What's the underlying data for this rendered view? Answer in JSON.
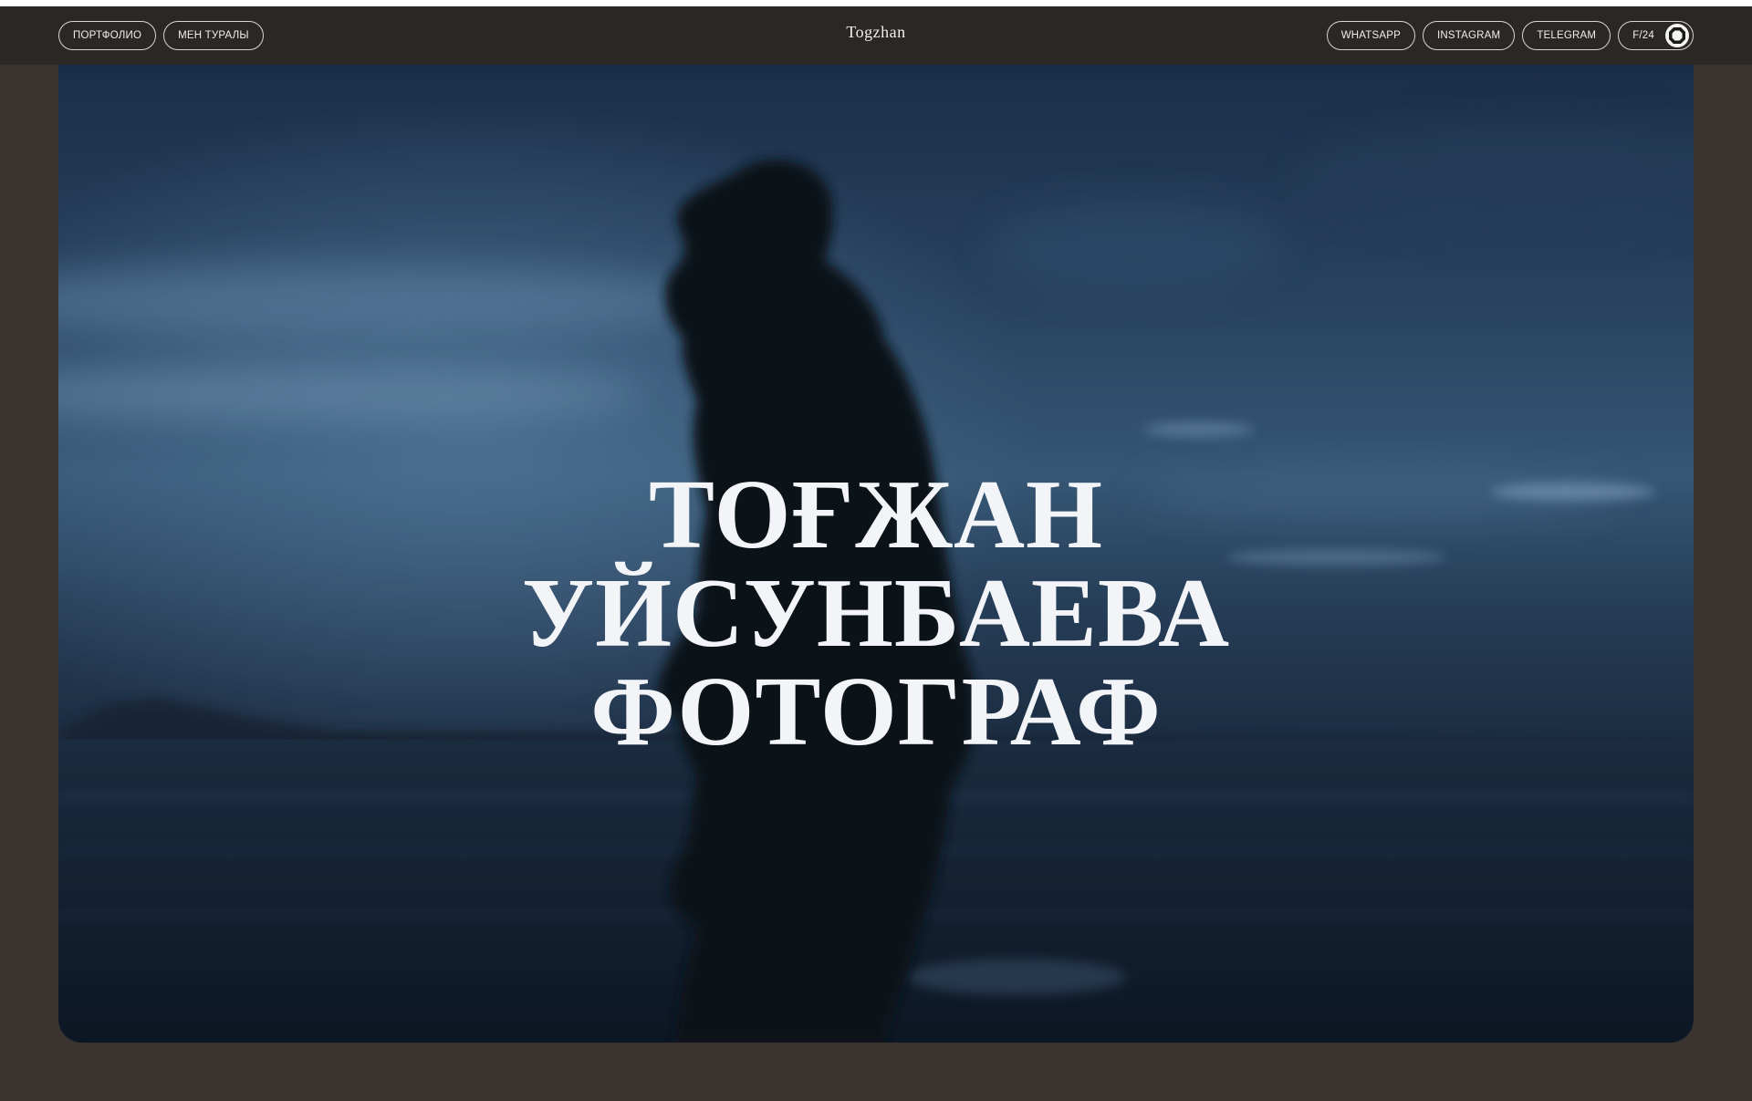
{
  "nav": {
    "left": [
      {
        "label": "ПОРТФОЛИО"
      },
      {
        "label": "МЕН ТУРАЛЫ"
      }
    ],
    "brand": "Togzhan",
    "right": [
      {
        "label": "WHATSAPP"
      },
      {
        "label": "INSTAGRAM"
      },
      {
        "label": "TELEGRAM"
      }
    ],
    "counter": {
      "label": "F/24",
      "icon": "octagon-icon"
    }
  },
  "hero": {
    "title_lines": [
      "ТОҒЖАН",
      "УЙСУНБАЕВА",
      "ФОТОГРАФ"
    ]
  },
  "colors": {
    "page_background": "#3a332f",
    "navbar_background": "#2a2724",
    "text": "#f1efea",
    "photo_sky": "#3e6385",
    "photo_sea": "#1c2e44"
  }
}
